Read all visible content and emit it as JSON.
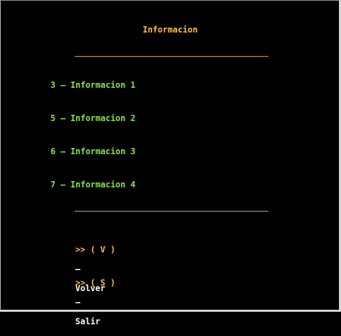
{
  "screen": {
    "title": "Informacion"
  },
  "menu": {
    "items": [
      {
        "label": "3 – Informacion 1"
      },
      {
        "label": "5 – Informacion 2"
      },
      {
        "label": "6 – Informacion 3"
      },
      {
        "label": "7 – Informacion 4"
      }
    ]
  },
  "actions": {
    "volver": {
      "prompt": ">> ( V )",
      "separator": "–",
      "label": "Volver"
    },
    "salir": {
      "prompt": ">> ( S )",
      "separator": "–",
      "label": "Salir"
    }
  },
  "colors": {
    "background": "#000000",
    "title": "#ffbf3f",
    "menu_text": "#88e844",
    "divider": "#e0a54a",
    "action_prompt": "#ffbf3f",
    "action_label": "#ffffff"
  }
}
